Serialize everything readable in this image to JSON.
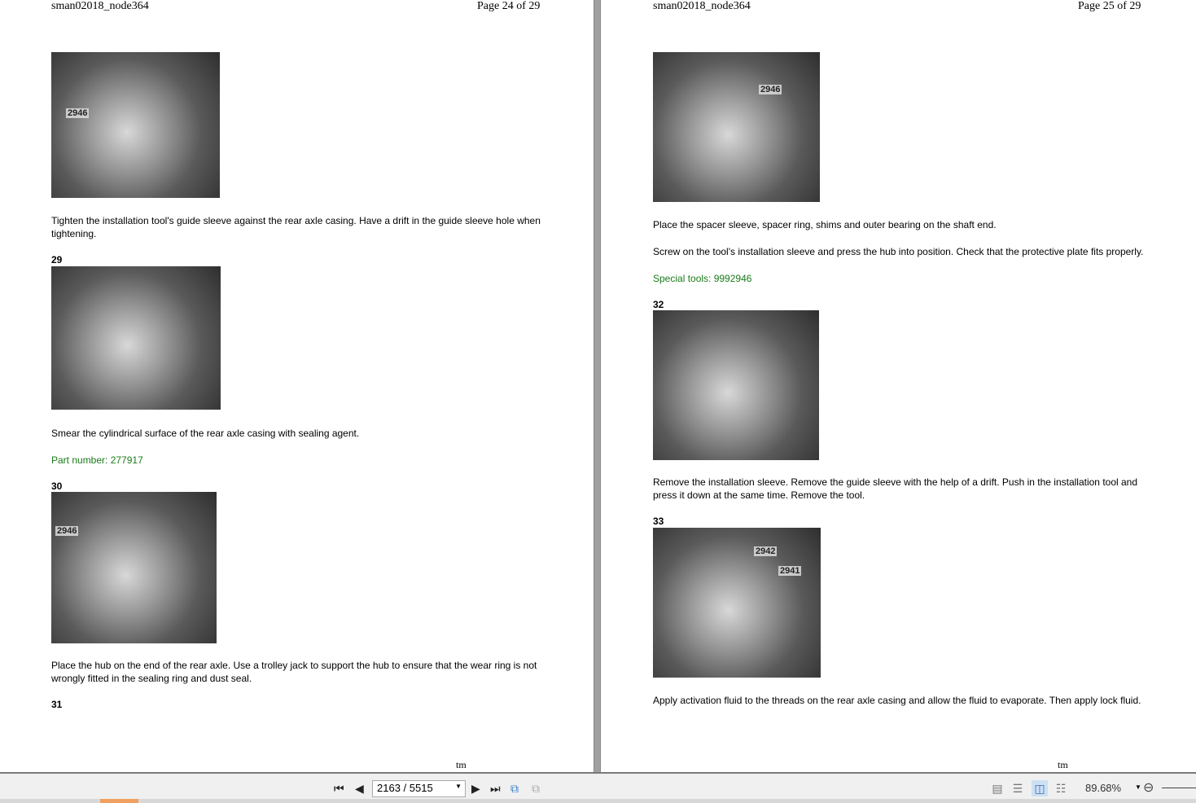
{
  "left_page": {
    "header_doc": "sman02018_node364",
    "header_page": "Page 24 of 29",
    "photo1_label": "2946",
    "text1": "Tighten the installation tool's guide sleeve against the rear axle casing. Have a drift in the guide sleeve hole when tightening.",
    "step29": "29",
    "text2": "Smear the cylindrical surface of the rear axle casing with sealing agent.",
    "part_number": "Part number: 277917",
    "step30": "30",
    "photo3_label": "2946",
    "text3": "Place the hub on the end of the rear axle. Use a trolley jack to support the hub to ensure that the wear ring is not wrongly fitted in the sealing ring and dust seal.",
    "step31": "31",
    "footer": "tm"
  },
  "right_page": {
    "header_doc": "sman02018_node364",
    "header_page": "Page 25 of 29",
    "photo1_label": "2946",
    "text1": "Place the spacer sleeve, spacer ring, shims and outer bearing on the shaft end.",
    "text2": "Screw on the tool's installation sleeve and press the hub into position. Check that the protective plate fits properly.",
    "special_tools": "Special tools: 9992946",
    "step32": "32",
    "text3": "Remove the installation sleeve. Remove the guide sleeve with the help of a drift. Push in the installation tool and press it down at the same time. Remove the tool.",
    "step33": "33",
    "photo3_label_a": "2942",
    "photo3_label_b": "2941",
    "text4": "Apply activation fluid to the threads on the rear axle casing and allow the fluid to evaporate. Then apply lock fluid.",
    "footer": "tm"
  },
  "toolbar": {
    "page_value": "2163 / 5515",
    "zoom": "89.68%"
  },
  "colors": {
    "green": "#1a7a1a",
    "toolbar": "#f0f0f0"
  }
}
